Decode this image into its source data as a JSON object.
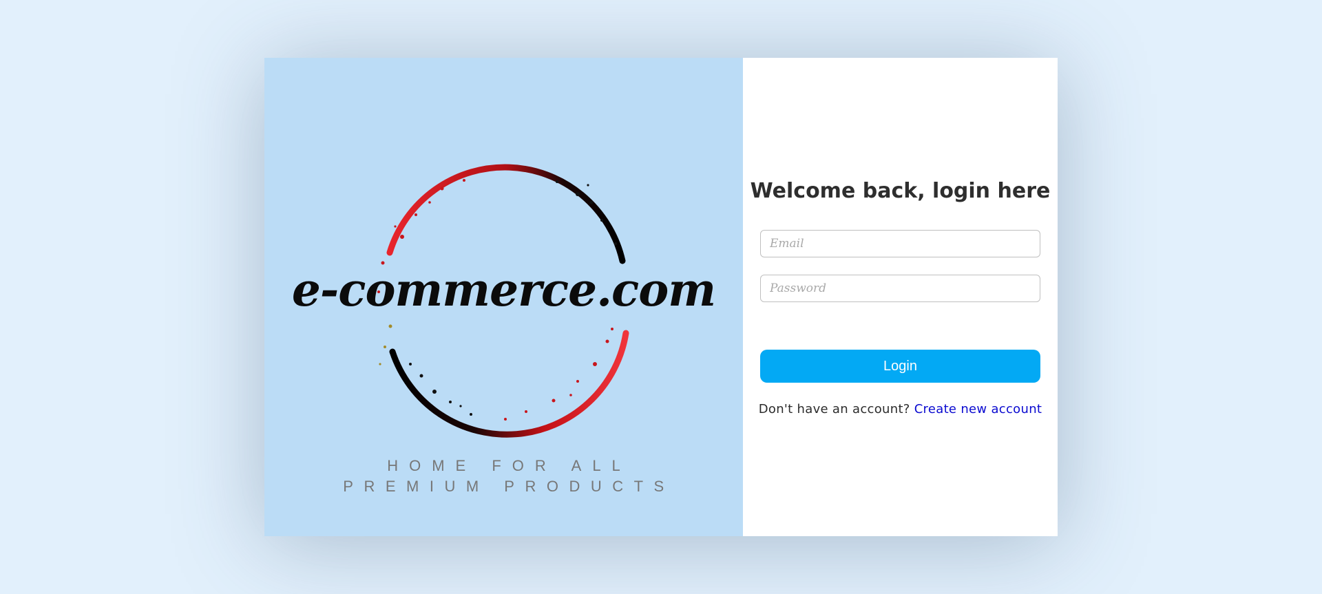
{
  "brand": {
    "wordmark": "e-commerce.com",
    "tagline_line1": "HOME FOR ALL",
    "tagline_line2": "PREMIUM PRODUCTS",
    "ring_colors": {
      "red": "#e8252c",
      "dark": "#1a0606"
    }
  },
  "login": {
    "heading": "Welcome back, login here",
    "email_placeholder": "Email",
    "password_placeholder": "Password",
    "submit_label": "Login",
    "signup_prompt": "Don't have an account?",
    "signup_link_label": "Create new account",
    "accent_color": "#03a9f4",
    "link_color": "#0a0ad0"
  }
}
